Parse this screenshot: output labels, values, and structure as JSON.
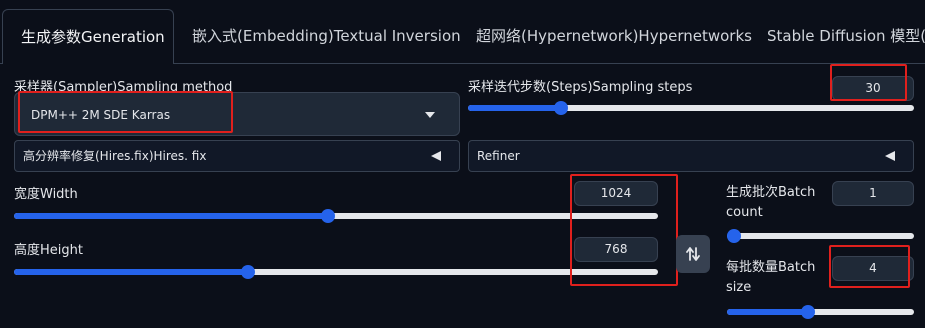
{
  "tabs": [
    {
      "label": "生成参数Generation",
      "active": true
    },
    {
      "label": "嵌入式(Embedding)Textual Inversion",
      "active": false
    },
    {
      "label": "超网络(Hypernetwork)Hypernetworks",
      "active": false
    },
    {
      "label": "Stable Diffusion 模型(ck",
      "active": false
    }
  ],
  "sampler": {
    "label": "采样器(Sampler)Sampling method",
    "value": "DPM++ 2M SDE Karras"
  },
  "steps": {
    "label": "采样迭代步数(Steps)Sampling steps",
    "value": "30",
    "fraction": 0.2
  },
  "hires": {
    "label": "高分辨率修复(Hires.fix)Hires. fix"
  },
  "refiner": {
    "label": "Refiner"
  },
  "width": {
    "label": "宽度Width",
    "value": "1024",
    "fraction": 0.487
  },
  "height": {
    "label": "高度Height",
    "value": "768",
    "fraction": 0.36
  },
  "batch_count": {
    "label": "生成批次Batch count",
    "value": "1",
    "fraction": 0.0
  },
  "batch_size": {
    "label": "每批数量Batch size",
    "value": "4",
    "fraction": 0.43
  },
  "colors": {
    "accent": "#2563eb",
    "highlight": "#e0201d",
    "background": "#0b0f19"
  }
}
